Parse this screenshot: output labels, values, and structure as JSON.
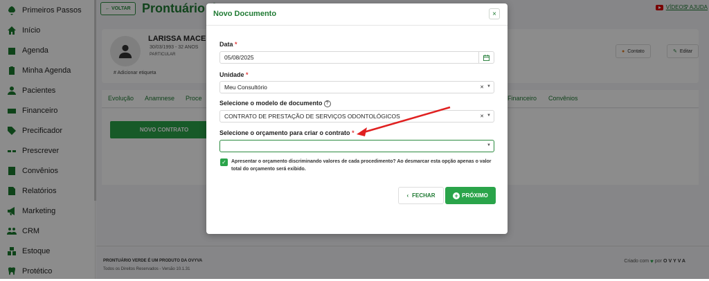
{
  "sidebar": {
    "items": [
      {
        "label": "Primeiros Passos",
        "icon": "rocket-icon"
      },
      {
        "label": "Início",
        "icon": "home-icon"
      },
      {
        "label": "Agenda",
        "icon": "calendar-icon"
      },
      {
        "label": "Minha Agenda",
        "icon": "clipboard-icon"
      },
      {
        "label": "Pacientes",
        "icon": "user-icon"
      },
      {
        "label": "Financeiro",
        "icon": "money-icon"
      },
      {
        "label": "Precificador",
        "icon": "tag-icon"
      },
      {
        "label": "Prescrever",
        "icon": "pills-icon"
      },
      {
        "label": "Convênios",
        "icon": "building-icon"
      },
      {
        "label": "Relatórios",
        "icon": "report-icon"
      },
      {
        "label": "Marketing",
        "icon": "megaphone-icon"
      },
      {
        "label": "CRM",
        "icon": "users-icon"
      },
      {
        "label": "Estoque",
        "icon": "boxes-icon"
      },
      {
        "label": "Protético",
        "icon": "tooth-icon"
      }
    ]
  },
  "topbar": {
    "back_label": "← VOLTAR",
    "title": "Prontuário do",
    "videos_label": "VÍDEOS",
    "help_label": "AJUDA"
  },
  "patient": {
    "name": "LARISSA MACED",
    "dob": "30/03/1993 - 32 ANOS",
    "plan": "PARTICULAR",
    "tag_label": "# Adicionar etiqueta",
    "contact_label": "Contato",
    "edit_label": "Editar"
  },
  "tabs": [
    "Evolução",
    "Anamnese",
    "Proce",
    "Financeiro",
    "Convênios"
  ],
  "content": {
    "new_contract_label": "NOVO CONTRATO"
  },
  "footer": {
    "line1": "PRONTUÁRIO VERDE É UM PRODUTO DA OVYVA",
    "line2": "Todos os Direitos Reservados - Versão 10.1.31",
    "created_with": "Criado com",
    "por": "por",
    "brand": "OVYVA"
  },
  "modal": {
    "title": "Novo Documento",
    "close": "×",
    "date_label": "Data",
    "date_value": "05/08/2025",
    "unit_label": "Unidade",
    "unit_value": "Meu Consultório",
    "model_label": "Selecione o modelo de documento",
    "model_value": "CONTRATO DE PRESTAÇÃO DE SERVIÇOS ODONTOLÓGICOS",
    "budget_label": "Selecione o orçamento para criar o contrato",
    "budget_value": "",
    "required_mark": "*",
    "checkbox_text": "Apresentar o orçamento discriminando valores de cada procedimento? Ao desmarcar esta opção apenas o valor total do orçamento será exibido.",
    "checkbox_checked": true,
    "close_button": "FECHAR",
    "next_button": "PRÓXIMO"
  },
  "colors": {
    "accent": "#1f7a33",
    "button": "#2aa44a",
    "required": "#e23c3c",
    "arrow": "#e02020"
  }
}
